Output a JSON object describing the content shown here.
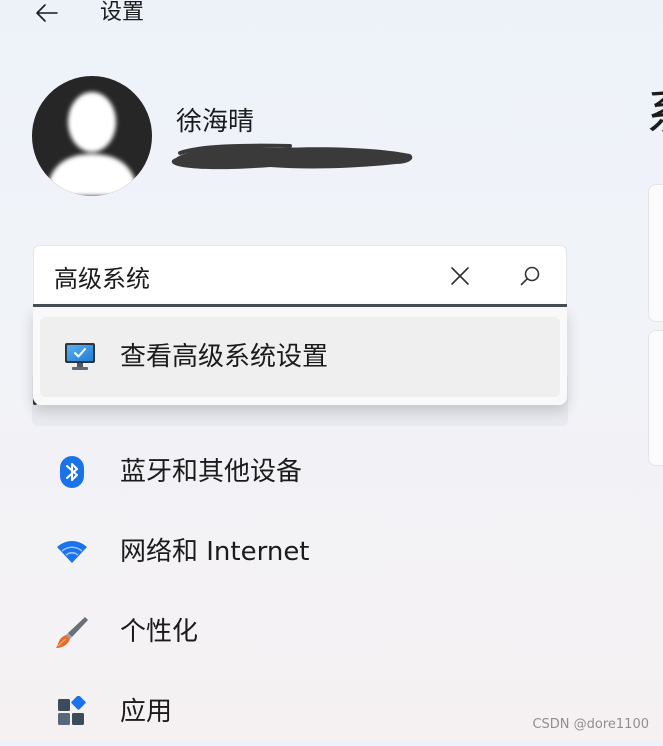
{
  "window": {
    "title": "设置"
  },
  "user": {
    "name": "徐海晴"
  },
  "right_panel": {
    "heading": "系"
  },
  "search": {
    "value": "高级系统",
    "clear_icon": "close-icon",
    "search_icon": "search-icon"
  },
  "suggestions": [
    {
      "label": "查看高级系统设置",
      "icon": "system-monitor-icon"
    }
  ],
  "nav": {
    "items": [
      {
        "label": "蓝牙和其他设备",
        "icon": "bluetooth-icon",
        "color": "#1a73e8"
      },
      {
        "label": "网络和 Internet",
        "icon": "wifi-icon",
        "color": "#1a73e8"
      },
      {
        "label": "个性化",
        "icon": "paintbrush-icon",
        "color": "#e0703a"
      },
      {
        "label": "应用",
        "icon": "apps-icon",
        "color": "#3c4b5c"
      }
    ]
  },
  "watermark": "CSDN @dore1100"
}
